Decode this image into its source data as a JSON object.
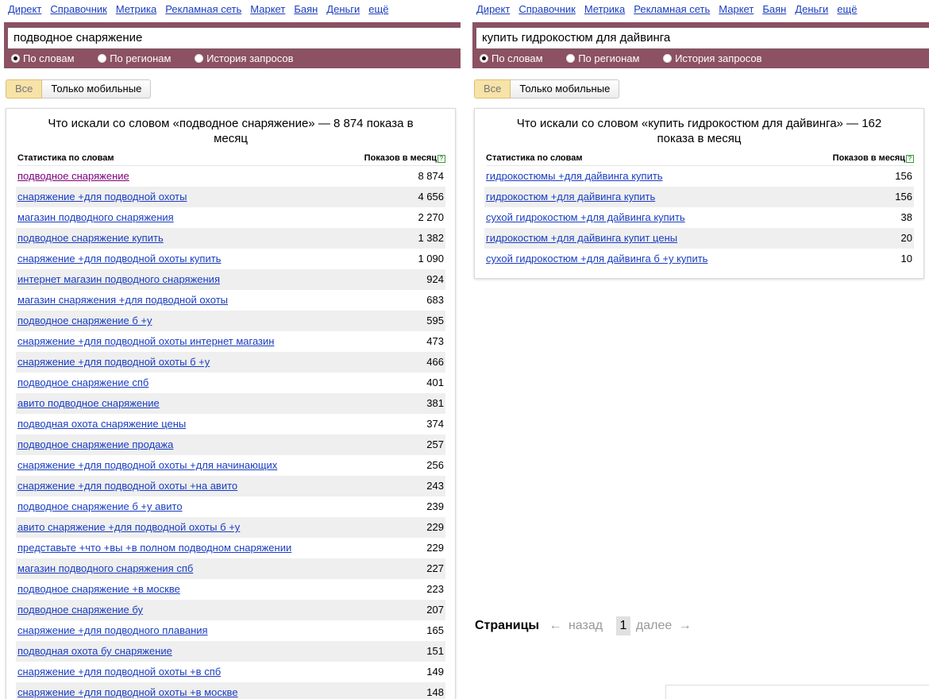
{
  "services": [
    "Директ",
    "Справочник",
    "Метрика",
    "Рекламная сеть",
    "Маркет",
    "Баян",
    "Деньги",
    "ещё"
  ],
  "radios": [
    "По словам",
    "По регионам",
    "История запросов"
  ],
  "filters": [
    "Все",
    "Только мобильные"
  ],
  "table_header": {
    "left": "Статистика по словам",
    "right": "Показов в месяц",
    "help": "?"
  },
  "left": {
    "query": "подводное снаряжение",
    "title": "Что искали со словом «подводное снаряжение» — 8 874 показа в месяц",
    "rows": [
      {
        "phrase": "подводное снаряжение",
        "count": "8 874"
      },
      {
        "phrase": "снаряжение +для подводной охоты",
        "count": "4 656"
      },
      {
        "phrase": "магазин подводного снаряжения",
        "count": "2 270"
      },
      {
        "phrase": "подводное снаряжение купить",
        "count": "1 382"
      },
      {
        "phrase": "снаряжение +для подводной охоты купить",
        "count": "1 090"
      },
      {
        "phrase": "интернет магазин подводного снаряжения",
        "count": "924"
      },
      {
        "phrase": "магазин снаряжения +для подводной охоты",
        "count": "683"
      },
      {
        "phrase": "подводное снаряжение б +у",
        "count": "595"
      },
      {
        "phrase": "снаряжение +для подводной охоты интернет магазин",
        "count": "473"
      },
      {
        "phrase": "снаряжение +для подводной охоты б +у",
        "count": "466"
      },
      {
        "phrase": "подводное снаряжение спб",
        "count": "401"
      },
      {
        "phrase": "авито подводное снаряжение",
        "count": "381"
      },
      {
        "phrase": "подводная охота снаряжение цены",
        "count": "374"
      },
      {
        "phrase": "подводное снаряжение продажа",
        "count": "257"
      },
      {
        "phrase": "снаряжение +для подводной охоты +для начинающих",
        "count": "256"
      },
      {
        "phrase": "снаряжение +для подводной охоты +на авито",
        "count": "243"
      },
      {
        "phrase": "подводное снаряжение б +у авито",
        "count": "239"
      },
      {
        "phrase": "авито снаряжение +для подводной охоты б +у",
        "count": "229"
      },
      {
        "phrase": "представьте +что +вы +в полном подводном снаряжении",
        "count": "229"
      },
      {
        "phrase": "магазин подводного снаряжения спб",
        "count": "227"
      },
      {
        "phrase": "подводное снаряжение +в москве",
        "count": "223"
      },
      {
        "phrase": "подводное снаряжение бу",
        "count": "207"
      },
      {
        "phrase": "снаряжение +для подводного плавания",
        "count": "165"
      },
      {
        "phrase": "подводная охота бу снаряжение",
        "count": "151"
      },
      {
        "phrase": "снаряжение +для подводной охоты +в спб",
        "count": "149"
      },
      {
        "phrase": "снаряжение +для подводной охоты +в москве",
        "count": "148"
      }
    ]
  },
  "right": {
    "query": "купить гидрокостюм для дайвинга",
    "title": "Что искали со словом «купить гидрокостюм для дайвинга» — 162 показа в месяц",
    "rows": [
      {
        "phrase": "гидрокостюмы +для дайвинга купить",
        "count": "156"
      },
      {
        "phrase": "гидрокостюм +для дайвинга купить",
        "count": "156"
      },
      {
        "phrase": "сухой гидрокостюм +для дайвинга купить",
        "count": "38"
      },
      {
        "phrase": "гидрокостюм +для дайвинга купит цены",
        "count": "20"
      },
      {
        "phrase": "сухой гидрокостюм +для дайвинга б +у купить",
        "count": "10"
      }
    ]
  },
  "pager": {
    "label": "Страницы",
    "prev_arrow": "←",
    "prev": "назад",
    "current": "1",
    "next": "далее",
    "next_arrow": "→"
  }
}
